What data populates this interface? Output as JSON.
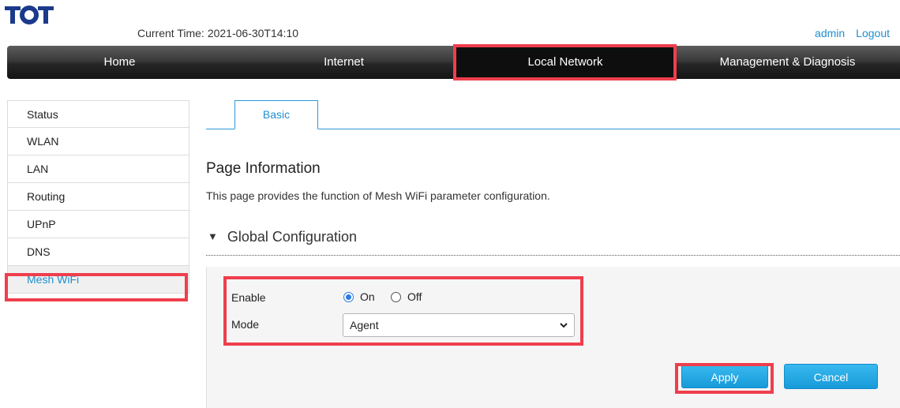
{
  "brand": {
    "logo_text": "TOT",
    "logo_color": "#1b3a8c"
  },
  "header": {
    "current_time_label": "Current Time:",
    "current_time_value": "2021-06-30T14:10",
    "user_link": "admin",
    "logout_link": "Logout"
  },
  "nav": {
    "items": [
      {
        "label": "Home"
      },
      {
        "label": "Internet"
      },
      {
        "label": "Local Network"
      },
      {
        "label": "Management & Diagnosis"
      }
    ],
    "active_index": 2
  },
  "sidebar": {
    "items": [
      {
        "label": "Status"
      },
      {
        "label": "WLAN"
      },
      {
        "label": "LAN"
      },
      {
        "label": "Routing"
      },
      {
        "label": "UPnP"
      },
      {
        "label": "DNS"
      },
      {
        "label": "Mesh WiFi"
      }
    ],
    "active_index": 6
  },
  "tabs": {
    "items": [
      {
        "label": "Basic"
      }
    ]
  },
  "page": {
    "title": "Page Information",
    "description": "This page provides the function of Mesh WiFi parameter configuration."
  },
  "section": {
    "title": "Global Configuration",
    "icon": "triangle-down-icon"
  },
  "form": {
    "enable_label": "Enable",
    "enable_on_label": "On",
    "enable_off_label": "Off",
    "enable_value": "On",
    "mode_label": "Mode",
    "mode_value": "Agent"
  },
  "buttons": {
    "apply": "Apply",
    "cancel": "Cancel"
  },
  "colors": {
    "accent": "#1f8fd0",
    "highlight": "#ef3e4d",
    "button": "#1da6e3"
  }
}
